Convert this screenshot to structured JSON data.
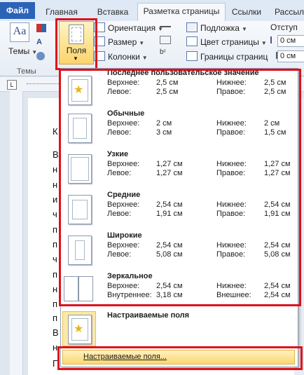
{
  "tabs": [
    "Файл",
    "Главная",
    "Вставка",
    "Разметка страницы",
    "Ссылки",
    "Рассыл"
  ],
  "ribbon": {
    "themes": "Темы",
    "themes_group": "Темы",
    "margins": "Поля",
    "orientation": "Ориентация",
    "size": "Размер",
    "columns": "Колонки",
    "watermark": "Подложка",
    "page_color": "Цвет страницы",
    "page_borders": "Границы страниц",
    "indent": "Отступ",
    "indent_left": "0 см",
    "indent_right": "0 см"
  },
  "document_lines": [
    "К",
    "В",
    "н",
    "н",
    "и",
    "ч",
    "п",
    "п",
    "ч",
    "п",
    "н",
    "п",
    "п",
    "В",
    "н",
    "П"
  ],
  "menu": {
    "items": [
      {
        "title": "Последнее пользовательское значение",
        "l1": "Верхнее:",
        "v1": "2,5 см",
        "l2": "Нижнее:",
        "v2": "2,5 см",
        "l3": "Левое:",
        "v3": "2,5 см",
        "l4": "Правое:",
        "v4": "2,5 см",
        "icon": "star"
      },
      {
        "title": "Обычные",
        "l1": "Верхнее:",
        "v1": "2 см",
        "l2": "Нижнее:",
        "v2": "2 см",
        "l3": "Левое:",
        "v3": "3 см",
        "l4": "Правое:",
        "v4": "1,5 см",
        "icon": "page"
      },
      {
        "title": "Узкие",
        "l1": "Верхнее:",
        "v1": "1,27 см",
        "l2": "Нижнее:",
        "v2": "1,27 см",
        "l3": "Левое:",
        "v3": "1,27 см",
        "l4": "Правое:",
        "v4": "1,27 см",
        "icon": "page"
      },
      {
        "title": "Средние",
        "l1": "Верхнее:",
        "v1": "2,54 см",
        "l2": "Нижнее:",
        "v2": "2,54 см",
        "l3": "Левое:",
        "v3": "1,91 см",
        "l4": "Правое:",
        "v4": "1,91 см",
        "icon": "page"
      },
      {
        "title": "Широкие",
        "l1": "Верхнее:",
        "v1": "2,54 см",
        "l2": "Нижнее:",
        "v2": "2,54 см",
        "l3": "Левое:",
        "v3": "5,08 см",
        "l4": "Правое:",
        "v4": "5,08 см",
        "icon": "page"
      },
      {
        "title": "Зеркальное",
        "l1": "Верхнее:",
        "v1": "2,54 см",
        "l2": "Нижнее:",
        "v2": "2,54 см",
        "l3": "Внутреннее:",
        "v3": "3,18 см",
        "l4": "Внешнее:",
        "v4": "2,54 см",
        "icon": "mirror"
      }
    ],
    "custom_title": "Настраиваемые поля",
    "custom_link": "Настраиваемые поля..."
  },
  "colors": {
    "highlight": "#e0101c",
    "file_tab": "#2b63b7",
    "hover": "#fde58b"
  }
}
